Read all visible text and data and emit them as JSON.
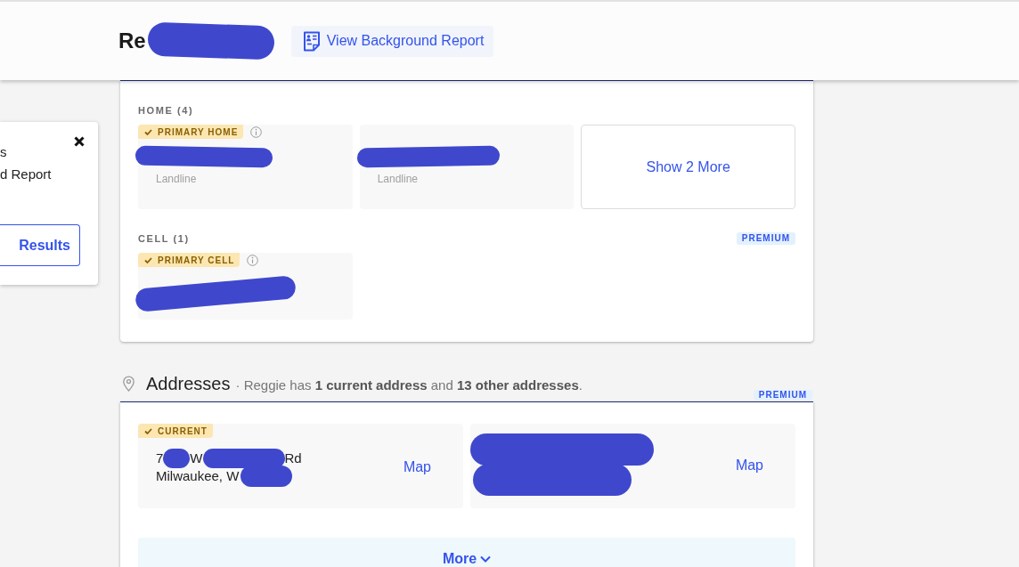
{
  "header": {
    "title": [
      {
        "kind": "text",
        "text": "Re"
      },
      {
        "kind": "redacted"
      }
    ],
    "report_button": {
      "label": "View Background Report"
    }
  },
  "side_panel": {
    "lines": [
      "s",
      "d Report"
    ],
    "button": {
      "label": "Results"
    }
  },
  "phones": {
    "sections": [
      {
        "heading": "HOME (4)",
        "items": [
          {
            "kind": "phone",
            "badge": "PRIMARY HOME",
            "number": [
              {
                "kind": "redacted"
              }
            ],
            "type": "Landline"
          },
          {
            "kind": "phone",
            "number": [
              {
                "kind": "redacted"
              }
            ],
            "type": "Landline"
          },
          {
            "kind": "more",
            "label": "Show 2 More"
          }
        ]
      },
      {
        "heading": "CELL (1)",
        "tag": "PREMIUM",
        "items": [
          {
            "kind": "phone",
            "badge": "PRIMARY CELL",
            "number": [
              {
                "kind": "redacted"
              }
            ]
          }
        ]
      }
    ]
  },
  "addresses": {
    "title": "Addresses",
    "summary": "· Reggie has **1 current address** and **13 other addresses**.",
    "tag": "PREMIUM",
    "items": [
      {
        "badge": "CURRENT",
        "lines": [
          {
            "segments": [
              {
                "kind": "text",
                "text": "7"
              },
              {
                "kind": "redacted"
              },
              {
                "kind": "text",
                "text": "W"
              },
              {
                "kind": "redacted"
              },
              {
                "kind": "text",
                "text": "Rd"
              }
            ]
          },
          {
            "segments": [
              {
                "kind": "text",
                "text": "Milwaukee, W"
              },
              {
                "kind": "redacted"
              }
            ]
          }
        ],
        "map_link": "Map"
      },
      {
        "lines": [
          {
            "segments": [
              {
                "kind": "redacted"
              }
            ]
          },
          {
            "segments": [
              {
                "kind": "redacted"
              }
            ]
          }
        ],
        "map_link": "Map"
      }
    ],
    "more_button": {
      "label": "More"
    }
  }
}
